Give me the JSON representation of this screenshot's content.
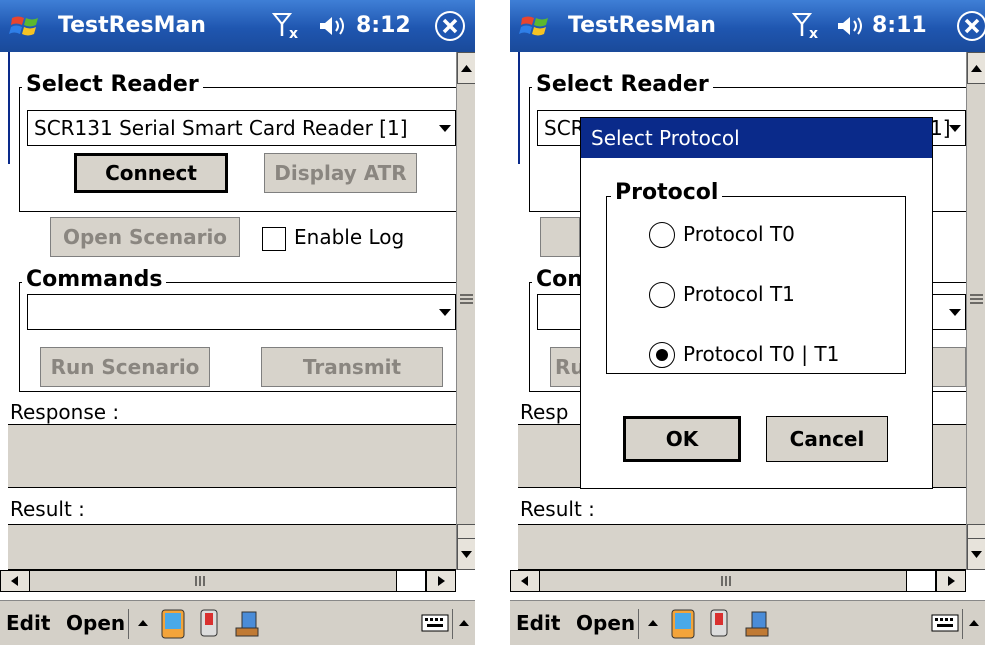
{
  "screens": [
    {
      "app_title": "TestResMan",
      "clock": "8:12",
      "select_reader": {
        "group_label": "Select Reader",
        "reader_value": "SCR131 Serial Smart Card Reader [1]",
        "connect_label": "Connect",
        "display_atr_label": "Display ATR"
      },
      "open_scenario_label": "Open Scenario",
      "enable_log_label": "Enable Log",
      "commands": {
        "group_label": "Commands",
        "command_value": "",
        "run_scenario_label": "Run Scenario",
        "transmit_label": "Transmit"
      },
      "response_label": "Response :",
      "result_label": "Result :",
      "menu": {
        "edit": "Edit",
        "open": "Open"
      }
    },
    {
      "app_title": "TestResMan",
      "clock": "8:11",
      "select_reader": {
        "group_label": "Select Reader",
        "reader_value_visible": "SCR",
        "reader_value_tail": "1]"
      },
      "commands": {
        "group_label_visible": "Con",
        "run_scenario_visible": "Ru"
      },
      "response_label_visible": "Resp",
      "result_label": "Result :",
      "menu": {
        "edit": "Edit",
        "open": "Open"
      },
      "dialog": {
        "title": "Select Protocol",
        "group_label": "Protocol",
        "options": [
          "Protocol T0",
          "Protocol T1",
          "Protocol T0 | T1"
        ],
        "selected_index": 2,
        "ok_label": "OK",
        "cancel_label": "Cancel"
      }
    }
  ],
  "colors": {
    "titlebar": "#2a63c0",
    "dialog_title": "#0a2a8a",
    "button_face": "#d7d3cb",
    "disabled_text": "#8a8680"
  }
}
